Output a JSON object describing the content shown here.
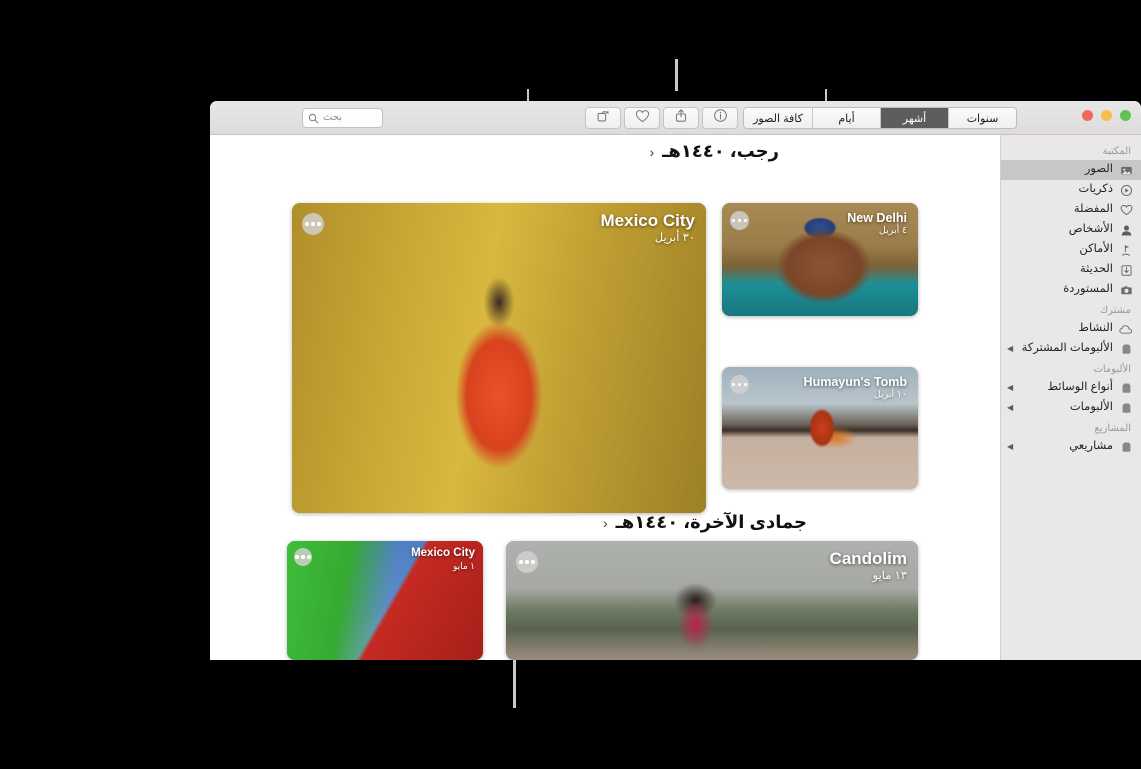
{
  "window": {
    "traffic_lights": [
      "green",
      "yellow",
      "red"
    ]
  },
  "toolbar": {
    "search": {
      "placeholder": "بحث",
      "value": "",
      "icon": "search-icon"
    },
    "buttons": [
      {
        "name": "rotate-button",
        "icon": "rotate-icon",
        "label": "تدوير"
      },
      {
        "name": "favorite-button",
        "icon": "heart-icon",
        "label": "المفضلة"
      },
      {
        "name": "share-button",
        "icon": "share-icon",
        "label": "مشاركة"
      },
      {
        "name": "info-button",
        "icon": "info-icon",
        "label": "معلومات"
      }
    ],
    "segmented_control": {
      "selected": "أشهر",
      "options": [
        {
          "label": "سنوات",
          "selected": false
        },
        {
          "label": "أشهر",
          "selected": true
        },
        {
          "label": "أيام",
          "selected": false
        },
        {
          "label": "كافة الصور",
          "selected": false
        }
      ]
    }
  },
  "sidebar": {
    "sections": [
      {
        "title": "المكتبة",
        "items": [
          {
            "label": "الصور",
            "icon": "photos-icon",
            "selected": true,
            "expandable": false
          },
          {
            "label": "ذكريات",
            "icon": "memories-icon",
            "selected": false,
            "expandable": false
          },
          {
            "label": "المفضلة",
            "icon": "heart-icon",
            "selected": false,
            "expandable": false
          },
          {
            "label": "الأشخاص",
            "icon": "person-icon",
            "selected": false,
            "expandable": false
          },
          {
            "label": "الأماكن",
            "icon": "places-pin-icon",
            "selected": false,
            "expandable": false
          },
          {
            "label": "الحديثة",
            "icon": "recents-icon",
            "selected": false,
            "expandable": false
          },
          {
            "label": "المستوردة",
            "icon": "imported-camera-icon",
            "selected": false,
            "expandable": false
          }
        ]
      },
      {
        "title": "مشترك",
        "items": [
          {
            "label": "النشاط",
            "icon": "cloud-icon",
            "selected": false,
            "expandable": false
          },
          {
            "label": "الألبومات المشتركة",
            "icon": "album-icon",
            "selected": false,
            "expandable": true
          }
        ]
      },
      {
        "title": "الألبومات",
        "items": [
          {
            "label": "أنواع الوسائط",
            "icon": "album-icon",
            "selected": false,
            "expandable": true
          },
          {
            "label": "الألبومات",
            "icon": "album-icon",
            "selected": false,
            "expandable": true
          }
        ]
      },
      {
        "title": "المشاريع",
        "items": [
          {
            "label": "مشاريعي",
            "icon": "album-icon",
            "selected": false,
            "expandable": true
          }
        ]
      }
    ]
  },
  "content": {
    "groups": [
      {
        "header": "رجب، ١٤٤٠هـ",
        "chevron": "‹",
        "photos": [
          {
            "title": "New Delhi",
            "date": "٤ أبريل"
          },
          {
            "title": "Humayun's Tomb",
            "date": "١٠ أبريل"
          },
          {
            "title": "Mexico City",
            "date": "٣٠ أبريل"
          }
        ]
      },
      {
        "header": "جمادى الآخرة، ١٤٤٠هـ",
        "chevron": "‹",
        "photos": [
          {
            "title": "Candolim",
            "date": "١٣ مايو"
          },
          {
            "title": "Mexico City",
            "date": "١ مايو"
          }
        ]
      }
    ]
  },
  "annotation": {
    "bracket_target": "أشهر",
    "has_top_bracket": true,
    "has_bottom_leader": true
  },
  "colors": {
    "background": "#000000",
    "window_chrome": "#e8e6e6",
    "sidebar": "#e9e7e7",
    "selected_segment": "#5e5c5c",
    "callout_line": "#c9c9c9"
  }
}
